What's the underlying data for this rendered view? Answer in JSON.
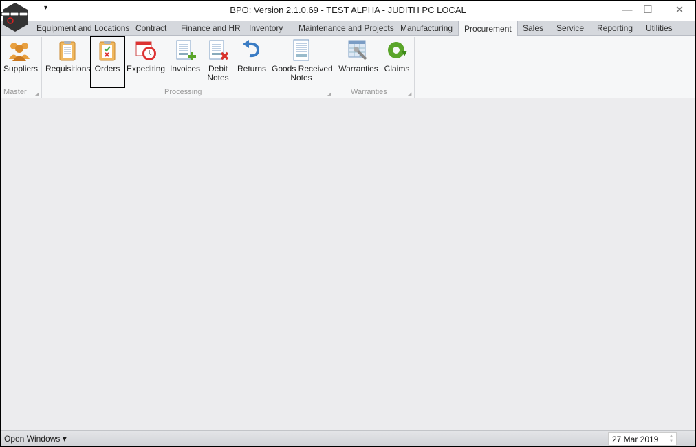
{
  "window": {
    "title": "BPO: Version 2.1.0.69 - TEST ALPHA - JUDITH PC LOCAL",
    "minimize": "—",
    "maximize": "☐",
    "close": "✕",
    "qat": "▾"
  },
  "tabs": [
    {
      "label": "Equipment and Locations"
    },
    {
      "label": "Contract"
    },
    {
      "label": "Finance and HR"
    },
    {
      "label": "Inventory"
    },
    {
      "label": "Maintenance and Projects"
    },
    {
      "label": "Manufacturing"
    },
    {
      "label": "Procurement",
      "active": true
    },
    {
      "label": "Sales"
    },
    {
      "label": "Service"
    },
    {
      "label": "Reporting"
    },
    {
      "label": "Utilities"
    }
  ],
  "ribbon": {
    "groups": [
      {
        "label": "Master"
      },
      {
        "label": "Processing"
      },
      {
        "label": "Warranties"
      }
    ],
    "buttons": [
      {
        "label": "Suppliers",
        "icon": "suppliers-icon"
      },
      {
        "label": "Requisitions",
        "icon": "clipboard-icon"
      },
      {
        "label": "Orders",
        "icon": "clipboard-check-icon",
        "selected": true
      },
      {
        "label": "Expediting",
        "icon": "calendar-clock-icon"
      },
      {
        "label": "Invoices",
        "icon": "document-add-icon"
      },
      {
        "label": "Debit",
        "label2": "Notes",
        "icon": "document-delete-icon"
      },
      {
        "label": "Returns",
        "icon": "undo-arrow-icon"
      },
      {
        "label": "Goods Received",
        "label2": "Notes",
        "icon": "document-icon"
      },
      {
        "label": "Warranties",
        "icon": "table-wrench-icon"
      },
      {
        "label": "Claims",
        "icon": "refresh-icon"
      }
    ]
  },
  "status": {
    "open_windows": "Open Windows ▾",
    "date": "27 Mar 2019"
  },
  "colors": {
    "accent_green": "#5aa52a",
    "accent_red": "#d8322c",
    "selection_border": "#000000"
  }
}
